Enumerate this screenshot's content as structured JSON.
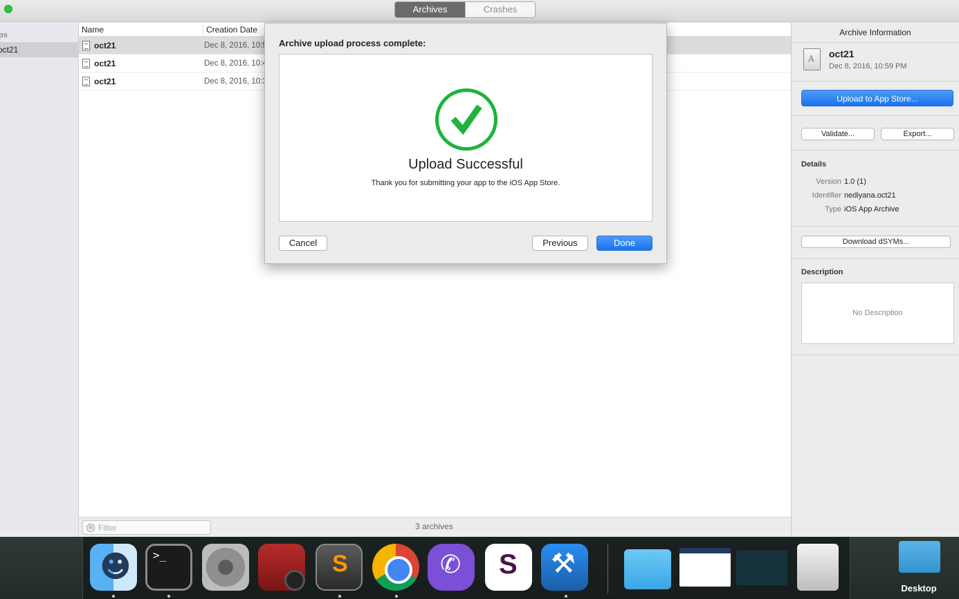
{
  "toolbar": {
    "tabs": [
      {
        "label": "Archives",
        "active": true
      },
      {
        "label": "Crashes",
        "active": false
      }
    ]
  },
  "sidebar": {
    "header": "ps",
    "items": [
      {
        "label": "oct21",
        "selected": true
      }
    ]
  },
  "table": {
    "columns": [
      "Name",
      "Creation Date"
    ],
    "rows": [
      {
        "name": "oct21",
        "date": "Dec 8, 2016, 10:5",
        "selected": true
      },
      {
        "name": "oct21",
        "date": "Dec 8, 2016, 10:4",
        "selected": false
      },
      {
        "name": "oct21",
        "date": "Dec 8, 2016, 10:3",
        "selected": false
      }
    ]
  },
  "bottom": {
    "filter_placeholder": "Filter",
    "count": "3 archives"
  },
  "inspector": {
    "title": "Archive Information",
    "archive_name": "oct21",
    "archive_date": "Dec 8, 2016, 10:59 PM",
    "upload_label": "Upload to App Store...",
    "validate_label": "Validate...",
    "export_label": "Export...",
    "details_title": "Details",
    "details": [
      {
        "key": "Version",
        "value": "1.0 (1)"
      },
      {
        "key": "Identifier",
        "value": "nediyana.oct21"
      },
      {
        "key": "Type",
        "value": "iOS App Archive"
      }
    ],
    "dsyms_label": "Download dSYMs...",
    "description_title": "Description",
    "description_placeholder": "No Description"
  },
  "sheet": {
    "title": "Archive upload process complete:",
    "status_title": "Upload Successful",
    "status_message": "Thank you for submitting your app to the iOS App Store.",
    "cancel_label": "Cancel",
    "previous_label": "Previous",
    "done_label": "Done"
  },
  "dock": {
    "apps": [
      "finder-icon",
      "terminal-icon",
      "system-preferences-icon",
      "photo-booth-icon",
      "sublime-text-icon",
      "chrome-icon",
      "viber-icon",
      "slack-icon",
      "xcode-icon",
      "folder-icon",
      "window-thumbnail-icon",
      "window-thumbnail-icon",
      "trash-icon"
    ],
    "desktop_label": "Desktop"
  },
  "colors": {
    "accent": "#1a73ec",
    "success": "#1eb33d"
  }
}
